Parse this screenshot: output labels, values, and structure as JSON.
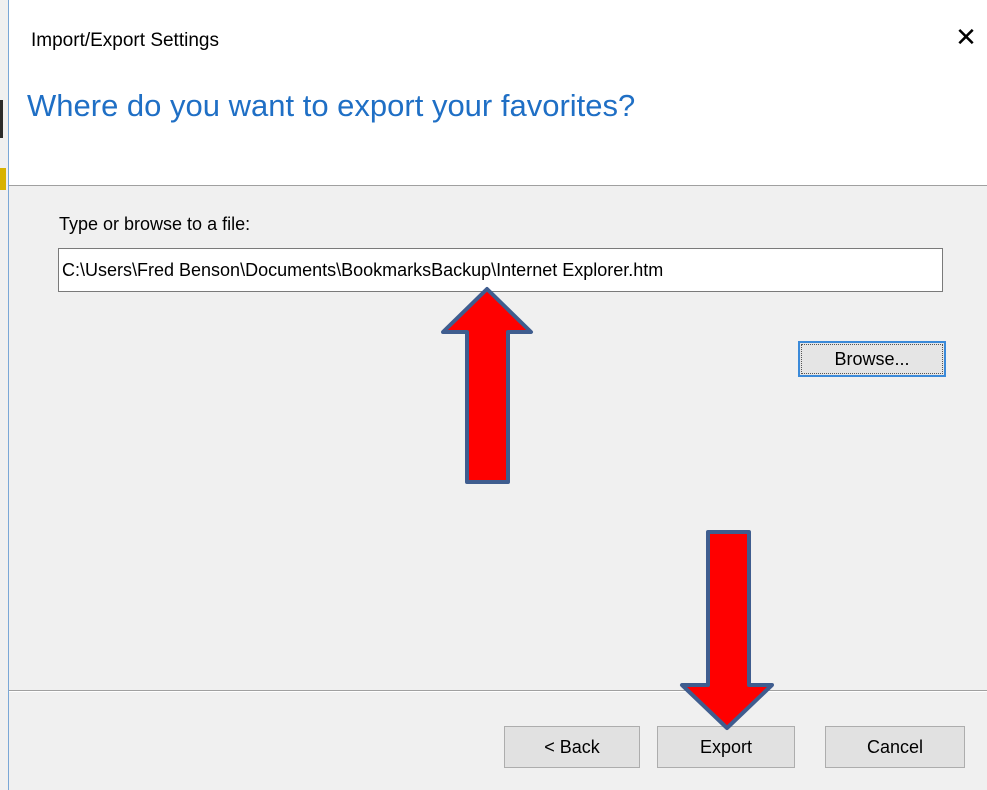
{
  "window": {
    "title": "Import/Export Settings",
    "close_glyph": "✕"
  },
  "header": {
    "title": "Where do you want to export your favorites?"
  },
  "form": {
    "label": "Type or browse to a file:",
    "path_value": "C:\\Users\\Fred Benson\\Documents\\BookmarksBackup\\Internet Explorer.htm",
    "browse_label": "Browse..."
  },
  "footer": {
    "back_label": "< Back",
    "export_label": "Export",
    "cancel_label": "Cancel"
  },
  "annotations": {
    "arrow_fill": "#ff0000",
    "arrow_stroke": "#3f5d8f",
    "up_arrow_target": "path-input",
    "down_arrow_target": "export-button"
  },
  "colors": {
    "header_title": "#1f6fc5",
    "focus_border": "#3b8ad9",
    "dialog_bg": "#f0f0f0"
  }
}
